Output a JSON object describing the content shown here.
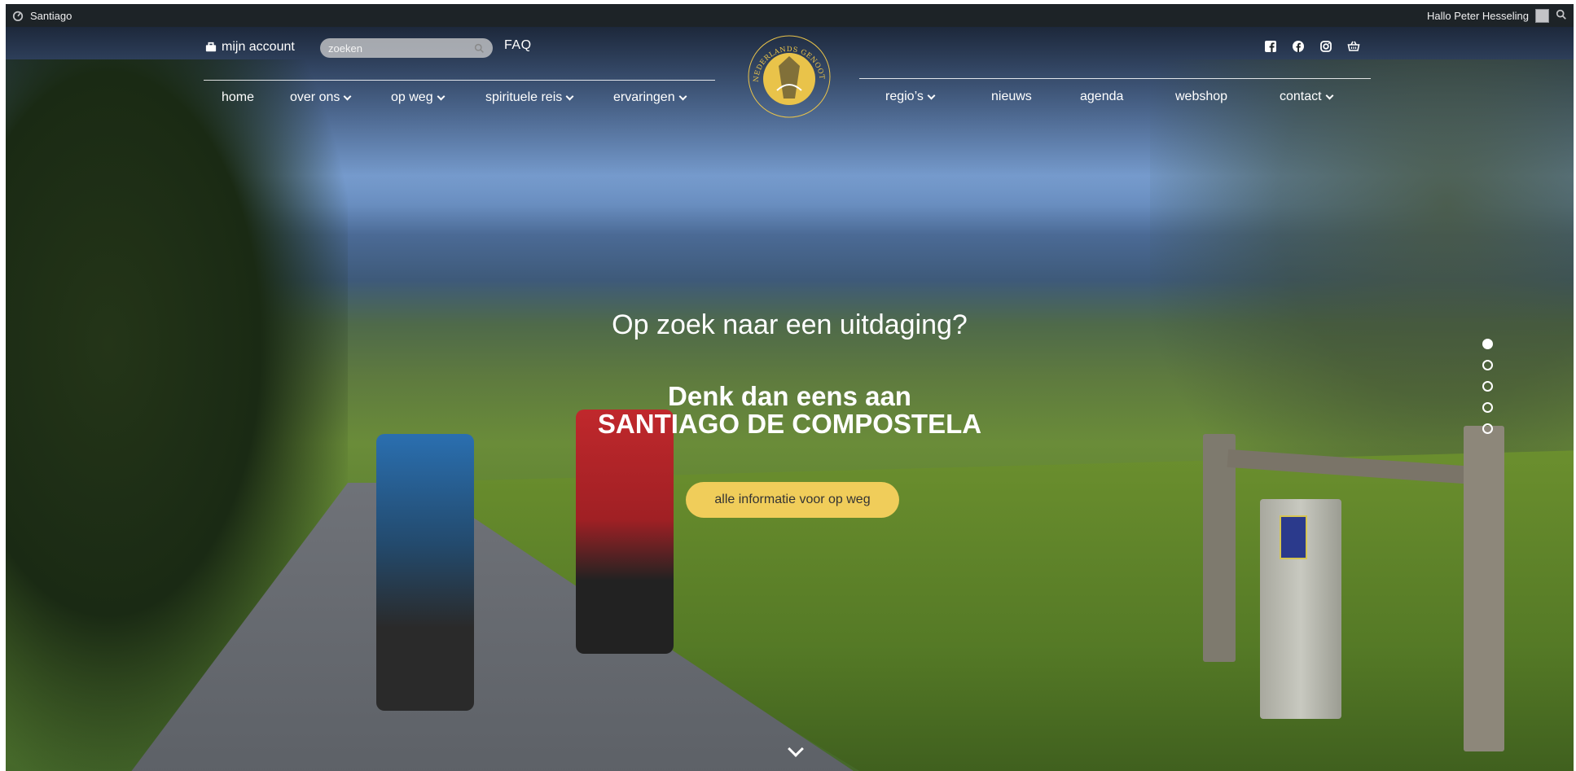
{
  "adminbar": {
    "site_name": "Santiago",
    "greeting": "Hallo Peter Hesseling"
  },
  "header": {
    "account_label": "mijn account",
    "search_placeholder": "zoeken",
    "faq_label": "FAQ",
    "nav_left": [
      {
        "label": "home",
        "has_dropdown": false
      },
      {
        "label": "over ons",
        "has_dropdown": true
      },
      {
        "label": "op weg",
        "has_dropdown": true
      },
      {
        "label": "spirituele reis",
        "has_dropdown": true
      },
      {
        "label": "ervaringen",
        "has_dropdown": true
      }
    ],
    "nav_right": [
      {
        "label": "regio’s",
        "has_dropdown": true
      },
      {
        "label": "nieuws",
        "has_dropdown": false
      },
      {
        "label": "agenda",
        "has_dropdown": false
      },
      {
        "label": "webshop",
        "has_dropdown": false
      },
      {
        "label": "contact",
        "has_dropdown": true
      }
    ],
    "social_icons": [
      "facebook-square-icon",
      "facebook-icon",
      "instagram-icon",
      "basket-icon"
    ],
    "logo_text": "NEDERLANDS GENOOTSCHAP VAN SINT JACOB"
  },
  "hero": {
    "subtitle": "Op zoek naar een uitdaging?",
    "headline_line1": "Denk dan eens aan",
    "headline_line2": "SANTIAGO DE COMPOSTELA",
    "cta_label": "alle informatie voor op weg",
    "slides": 5,
    "active_slide": 1
  },
  "colors": {
    "accent": "#f0cd5a",
    "adminbar": "#1d2327"
  }
}
